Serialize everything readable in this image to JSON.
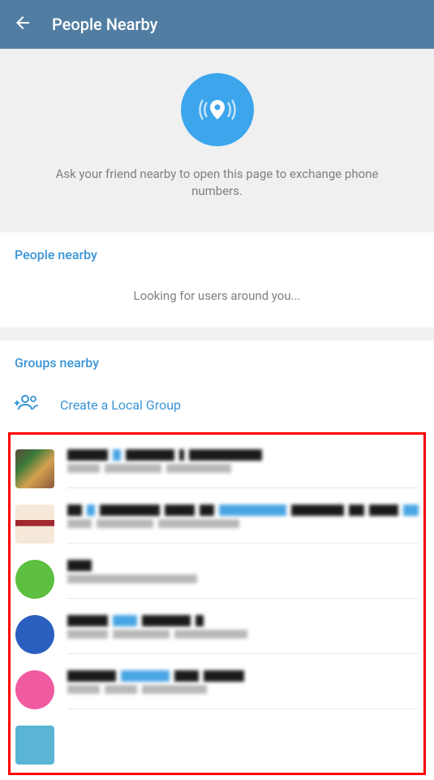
{
  "header": {
    "title": "People Nearby"
  },
  "intro": {
    "text": "Ask your friend nearby to open this page to exchange phone numbers."
  },
  "peopleNearby": {
    "title": "People nearby",
    "loadingText": "Looking for users around you..."
  },
  "groupsNearby": {
    "title": "Groups nearby",
    "createGroupLabel": "Create a Local Group",
    "items": [
      {
        "avatarColor": "av1",
        "nameBlocks": [
          50,
          10,
          60,
          6,
          90
        ],
        "subBlocks": [
          40,
          70,
          80
        ]
      },
      {
        "avatarColor": "av2",
        "nameBlocks": [
          20,
          10,
          80,
          40,
          20,
          90,
          70,
          20,
          40,
          20
        ],
        "subBlocks": [
          30,
          70,
          100
        ]
      },
      {
        "avatarColor": "av3",
        "nameBlocks": [
          30
        ],
        "subBlocks": [
          160
        ]
      },
      {
        "avatarColor": "av4",
        "nameBlocks": [
          50,
          30,
          60,
          10
        ],
        "subBlocks": [
          50,
          70,
          90
        ]
      },
      {
        "avatarColor": "av5",
        "nameBlocks": [
          60,
          60,
          30,
          50
        ],
        "subBlocks": [
          40,
          40,
          80
        ]
      },
      {
        "avatarColor": "av6",
        "nameBlocks": [],
        "subBlocks": []
      }
    ]
  }
}
